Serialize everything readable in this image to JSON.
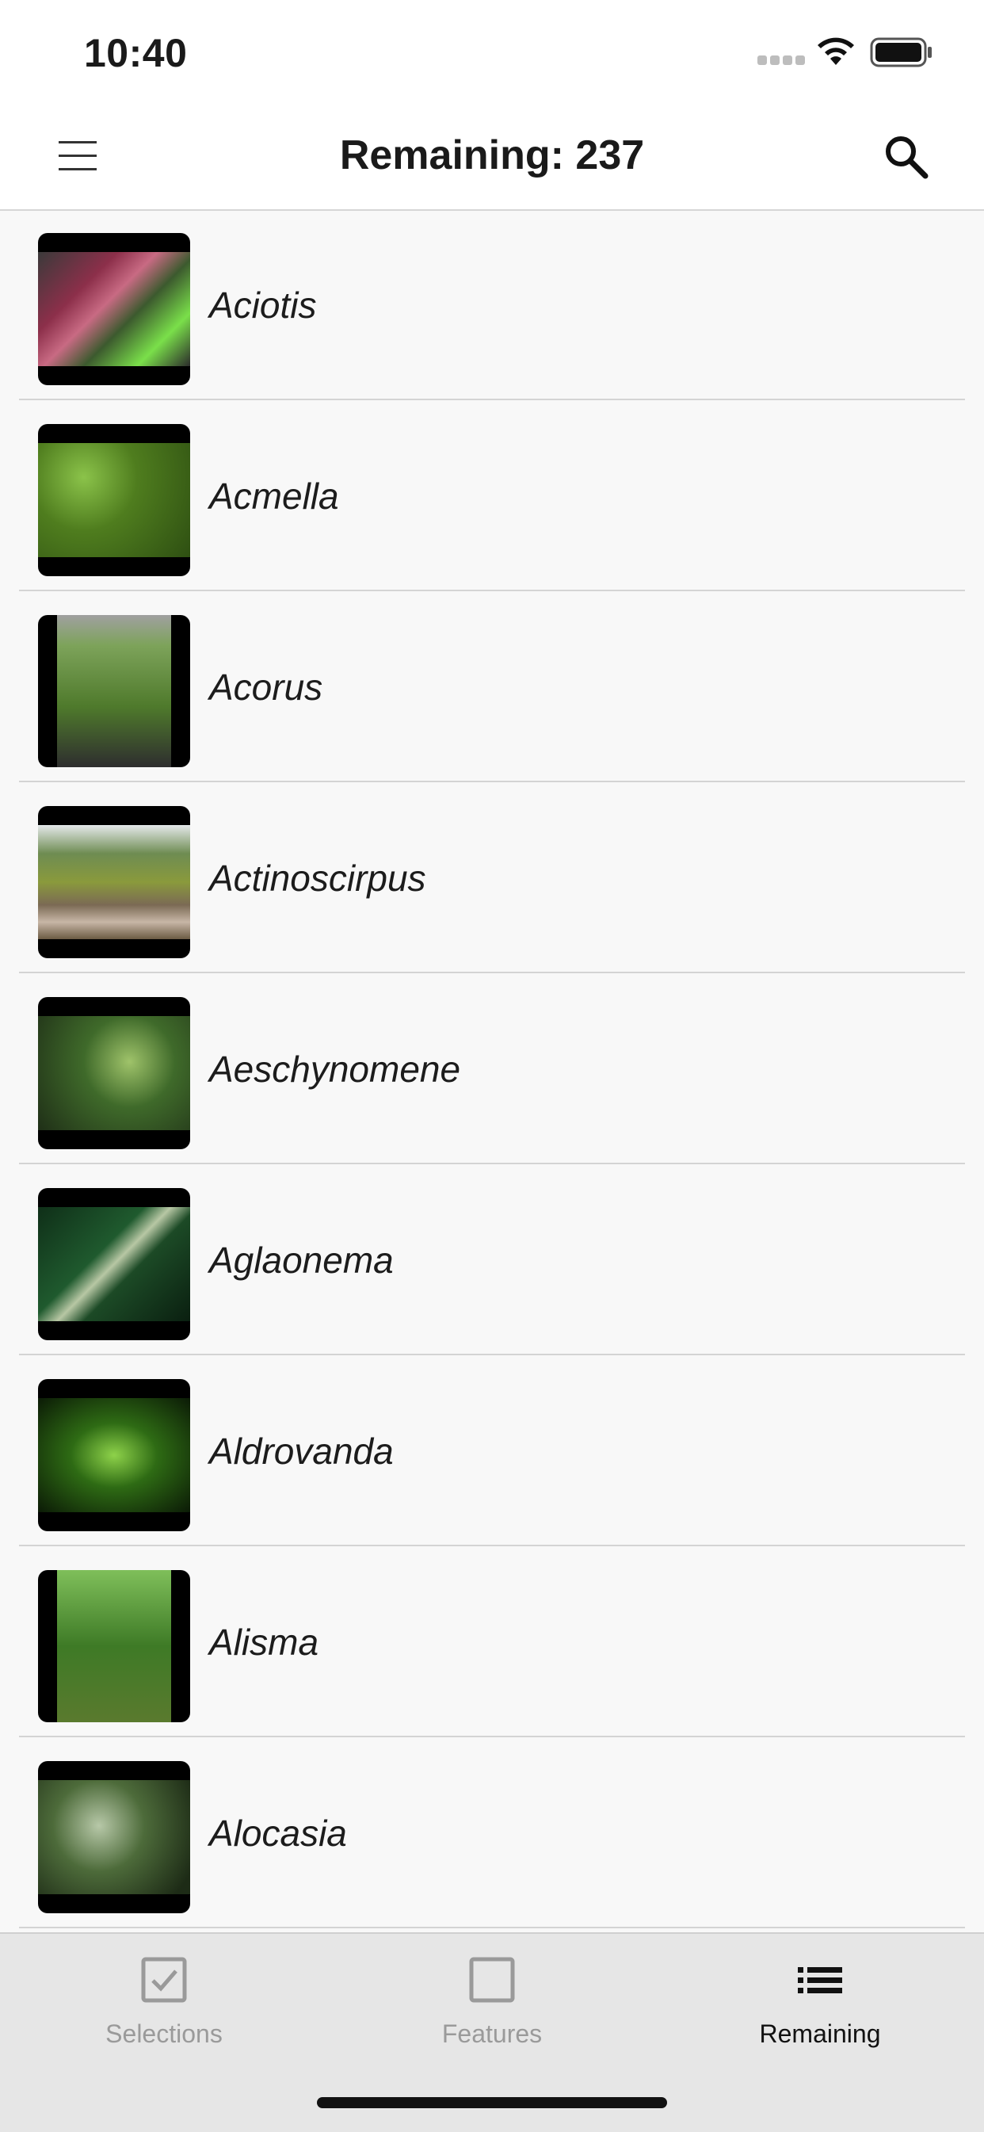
{
  "status_bar": {
    "time": "10:40"
  },
  "header": {
    "title": "Remaining: 237"
  },
  "list": {
    "items": [
      {
        "name": "Aciotis"
      },
      {
        "name": "Acmella"
      },
      {
        "name": "Acorus"
      },
      {
        "name": "Actinoscirpus"
      },
      {
        "name": "Aeschynomene"
      },
      {
        "name": "Aglaonema"
      },
      {
        "name": "Aldrovanda"
      },
      {
        "name": "Alisma"
      },
      {
        "name": "Alocasia"
      }
    ]
  },
  "tabs": [
    {
      "label": "Selections",
      "icon": "checkbox-checked-icon",
      "active": false
    },
    {
      "label": "Features",
      "icon": "checkbox-empty-icon",
      "active": false
    },
    {
      "label": "Remaining",
      "icon": "list-icon",
      "active": true
    }
  ],
  "colors": {
    "tab_inactive": "#9a9a9a",
    "tab_active": "#111111",
    "divider": "#d4d4d4"
  }
}
